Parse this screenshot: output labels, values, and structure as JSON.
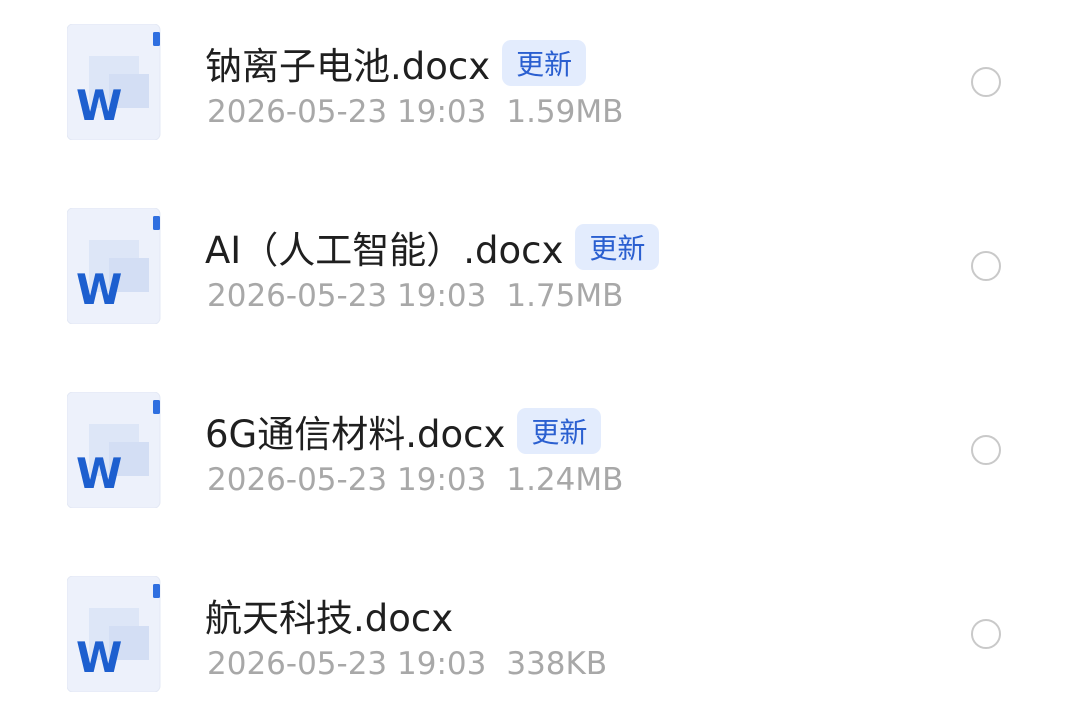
{
  "colors": {
    "badge_bg": "#e3ecfd",
    "badge_text": "#2a5fd0",
    "word_icon_blue": "#1d5fcf",
    "meta_text": "#a8a8a8"
  },
  "files": [
    {
      "name": "钠离子电池.docx",
      "badge": "更新",
      "date": "2026-05-23 19:03",
      "size": "1.59MB",
      "icon": "word-doc-icon",
      "icon_letter": "W"
    },
    {
      "name": "AI（人工智能）.docx",
      "badge": "更新",
      "date": "2026-05-23 19:03",
      "size": "1.75MB",
      "icon": "word-doc-icon",
      "icon_letter": "W"
    },
    {
      "name": "6G通信材料.docx",
      "badge": "更新",
      "date": "2026-05-23 19:03",
      "size": "1.24MB",
      "icon": "word-doc-icon",
      "icon_letter": "W"
    },
    {
      "name": "航天科技.docx",
      "badge": "",
      "date": "2026-05-23 19:03",
      "size": "338KB",
      "icon": "word-doc-icon",
      "icon_letter": "W"
    }
  ]
}
